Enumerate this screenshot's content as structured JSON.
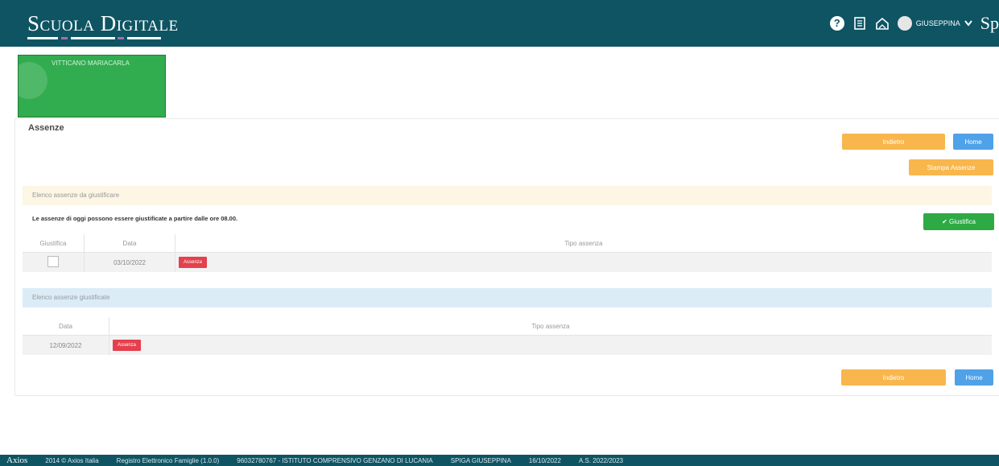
{
  "header": {
    "brand": "Scuola Digitale",
    "user_name": "GIUSEPPINA",
    "sp_label": "Sp",
    "icons": [
      "help-icon",
      "book-icon",
      "home-icon",
      "avatar",
      "chevron-down-icon"
    ]
  },
  "student": {
    "name": "VITTICANO MARIACARLA"
  },
  "page": {
    "title": "Assenze",
    "btn_back": "Indietro",
    "btn_home": "Home",
    "btn_print": "Stampa Assenze",
    "btn_justify": "Giustifica"
  },
  "to_justify": {
    "heading": "Elenco assenze da giustificare",
    "note": "Le assenze di oggi possono essere giustificate a partire dalle ore 08.00.",
    "columns": [
      "Giustifica",
      "Data",
      "Tipo assenza"
    ],
    "rows": [
      {
        "date": "03/10/2022",
        "type": "Assenza"
      }
    ]
  },
  "justified": {
    "heading": "Elenco assenze giustificate",
    "columns": [
      "Data",
      "Tipo assenza"
    ],
    "rows": [
      {
        "date": "12/09/2022",
        "type": "Assenza"
      }
    ]
  },
  "footer": {
    "logo": "Axios",
    "copyright": "2014 © Axios Italia",
    "product": "Registro Elettronico Famiglie (1.0.0)",
    "school": "96032780767 - ISTITUTO COMPRENSIVO GENZANO DI LUCANIA",
    "user": "SPIGA GIUSEPPINA",
    "date": "16/10/2022",
    "year": "A.S. 2022/2023"
  },
  "colors": {
    "topbar": "#0e5463",
    "student_card": "#31ac4f",
    "orange_button": "#f8b64c",
    "blue_button": "#4fa1e8",
    "green_button": "#2daa44",
    "badge": "#e4404d"
  }
}
